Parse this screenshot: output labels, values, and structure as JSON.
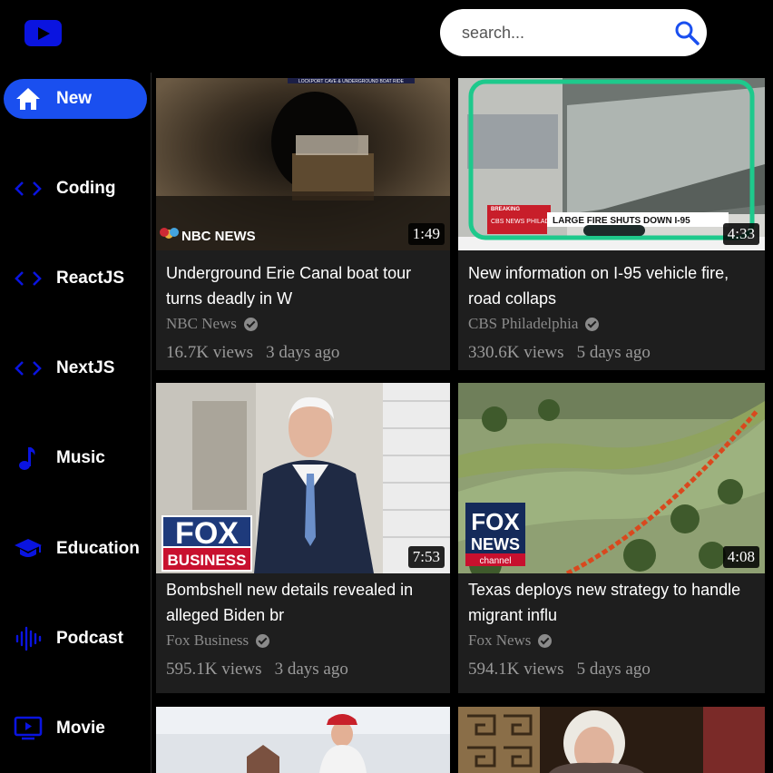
{
  "search": {
    "placeholder": "search..."
  },
  "colors": {
    "accent": "#1a4fef",
    "icon_blue": "#0a14e0",
    "card_bg": "#1e1e1e"
  },
  "sidebar": {
    "items": [
      {
        "label": "New",
        "icon": "home-icon",
        "active": true
      },
      {
        "label": "Coding",
        "icon": "code-icon"
      },
      {
        "label": "ReactJS",
        "icon": "code-icon"
      },
      {
        "label": "NextJS",
        "icon": "code-icon"
      },
      {
        "label": "Music",
        "icon": "music-note-icon"
      },
      {
        "label": "Education",
        "icon": "graduation-cap-icon"
      },
      {
        "label": "Podcast",
        "icon": "soundwave-icon"
      },
      {
        "label": "Movie",
        "icon": "tv-icon"
      }
    ]
  },
  "videos": [
    {
      "title": "Underground Erie Canal boat tour turns deadly in W",
      "channel": "NBC News",
      "views": "16.7K views",
      "age": "3 days ago",
      "duration": "1:49",
      "thumb_logo": "NBC NEWS",
      "thumb_banner": "LOCKPORT CAVE & UNDERGROUND BOAT RIDE"
    },
    {
      "title": "New information on I-95 vehicle fire, road collaps",
      "channel": "CBS Philadelphia",
      "views": "330.6K views",
      "age": "5 days ago",
      "duration": "4:33",
      "thumb_tag": "BREAKING",
      "thumb_logo": "CBS NEWS PHILADELPHIA",
      "thumb_headline": "LARGE FIRE SHUTS DOWN I-95"
    },
    {
      "title": "Bombshell new details revealed in alleged Biden br",
      "channel": "Fox Business",
      "views": "595.1K views",
      "age": "3 days ago",
      "duration": "7:53",
      "thumb_logo_top": "FOX",
      "thumb_logo_bottom": "BUSINESS"
    },
    {
      "title": "Texas deploys new strategy to handle migrant influ",
      "channel": "Fox News",
      "views": "594.1K views",
      "age": "5 days ago",
      "duration": "4:08",
      "thumb_logo_top": "FOX",
      "thumb_logo_mid": "NEWS",
      "thumb_logo_bottom": "channel"
    },
    {
      "title": "",
      "channel": "",
      "views": "",
      "age": "",
      "duration": ""
    },
    {
      "title": "",
      "channel": "",
      "views": "",
      "age": "",
      "duration": ""
    }
  ]
}
